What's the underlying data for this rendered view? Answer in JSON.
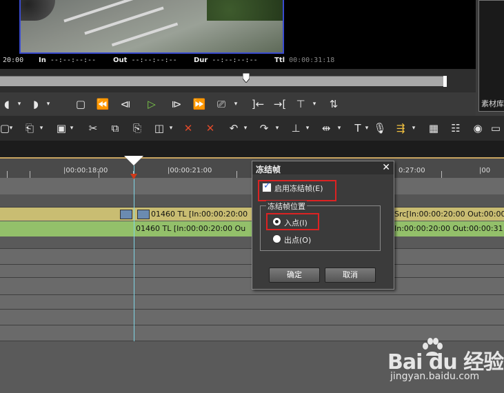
{
  "preview": {
    "timecodes": {
      "current": "20:00",
      "in_label": "In",
      "in_value": "--:--:--:--",
      "out_label": "Out",
      "out_value": "--:--:--:--",
      "dur_label": "Dur",
      "dur_value": "--:--:--:--",
      "ttl_label": "Ttl",
      "ttl_value": "00:00:31:18"
    }
  },
  "right_panel": {
    "materials_label": "素材库"
  },
  "ruler": {
    "ticks": [
      "|00:00:18:00",
      "|00:00:21:00",
      "0:27:00",
      "|00"
    ]
  },
  "tracks": {
    "tl_clip_text": "01460  TL [In:00:00:20:00",
    "tl_clip_right_text": "Src[In:00:00:20:00 Out:00:00:",
    "green_clip_text": "01460  TL [In:00:00:20:00 Ou",
    "green_clip_right_text": "In:00:00:20:00 Out:00:00:31"
  },
  "dialog": {
    "title": "冻结帧",
    "close": "✕",
    "enable_label": "启用冻结帧(E)",
    "enable_checked": true,
    "group_label": "冻结帧位置",
    "option_in": "入点(I)",
    "option_out": "出点(O)",
    "selected": "in",
    "ok_label": "确定",
    "cancel_label": "取消"
  },
  "watermark": {
    "logo": "Bai du 经验",
    "site": "jingyan.baidu.com"
  },
  "colors": {
    "highlight_box": "#d22222",
    "playhead": "#7fd6e6",
    "tl_clip": "#c9bd72",
    "green_clip": "#93c06a"
  }
}
